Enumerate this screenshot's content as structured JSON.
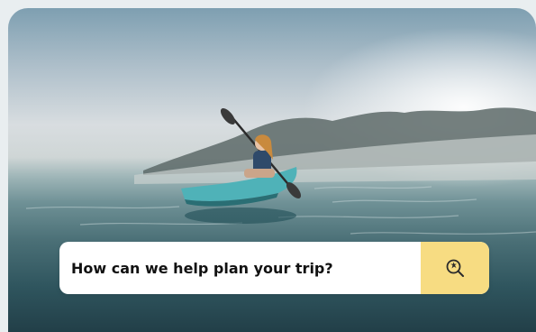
{
  "search": {
    "placeholder": "How can we help plan your trip?"
  },
  "search_button": {
    "icon": "search-travel-icon",
    "color": "#f7dc82"
  },
  "hero": {
    "image": "kayaker-on-misty-lake"
  }
}
